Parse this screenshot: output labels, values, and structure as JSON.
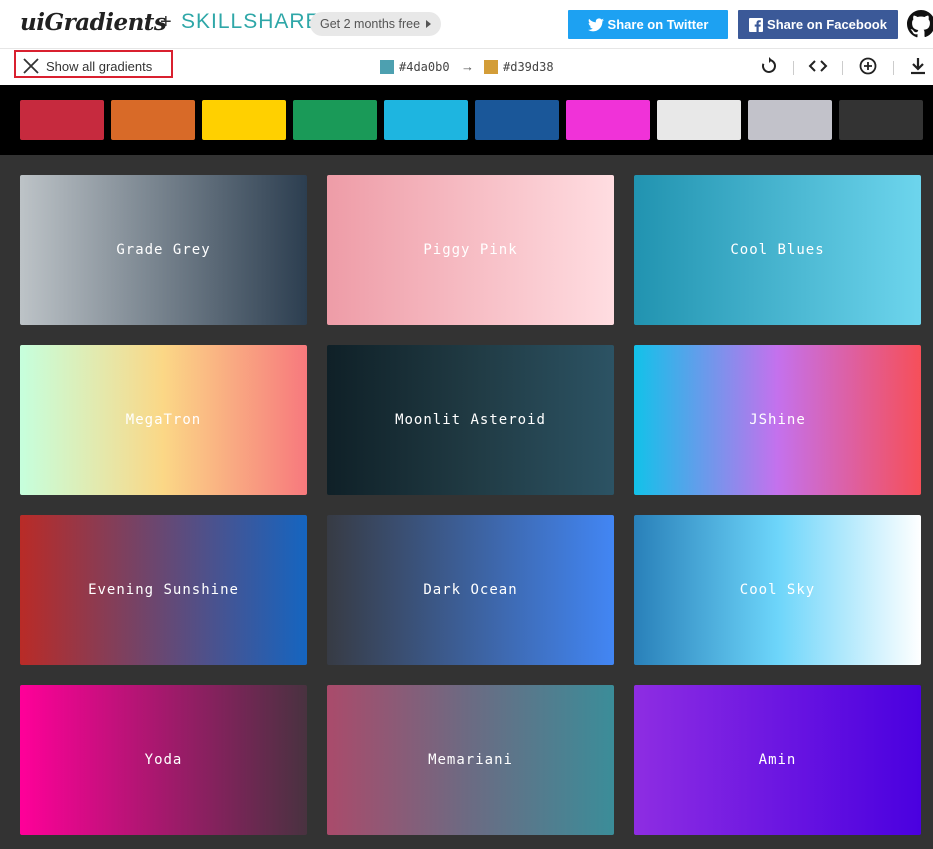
{
  "header": {
    "logo": "uiGradients",
    "plus": "+",
    "partner": "SKILLSHARE",
    "promo_label": "Get 2 months free",
    "twitter_label": "Share on Twitter",
    "facebook_label": "Share on Facebook",
    "github_icon": "github-icon"
  },
  "toolbar": {
    "show_all_label": "Show all gradients",
    "color_from": "#4da0b0",
    "color_to": "#d39d38",
    "arrow": "→",
    "icons": [
      "rotate-icon",
      "code-icon",
      "add-circle-icon",
      "download-icon"
    ]
  },
  "filter_colors": [
    "#c62a3e",
    "#d86a28",
    "#ffd000",
    "#1a9a58",
    "#1eb5e0",
    "#1a5799",
    "#f032d8",
    "#e8e8e8",
    "#c2c2ca",
    "#333333"
  ],
  "gradients": [
    {
      "name": "Grade Grey",
      "from": "#bdc3c7",
      "to": "#2c3e50"
    },
    {
      "name": "Piggy Pink",
      "from": "#ee9ca7",
      "to": "#ffdde1"
    },
    {
      "name": "Cool Blues",
      "from": "#2193b0",
      "to": "#6dd5ed"
    },
    {
      "name": "MegaTron",
      "from": "#c6ffdd",
      "mid": "#fbd786",
      "to": "#f7797d"
    },
    {
      "name": "Moonlit Asteroid",
      "from": "#0f2027",
      "mid": "#203a43",
      "to": "#2c5364"
    },
    {
      "name": "JShine",
      "from": "#12c2e9",
      "mid": "#c471ed",
      "to": "#f64f59"
    },
    {
      "name": "Evening Sunshine",
      "from": "#b92b27",
      "to": "#1565c0"
    },
    {
      "name": "Dark Ocean",
      "from": "#373b44",
      "to": "#4286f4"
    },
    {
      "name": "Cool Sky",
      "from": "#2980b9",
      "mid": "#6dd5fa",
      "to": "#ffffff"
    },
    {
      "name": "Yoda",
      "from": "#ff0099",
      "to": "#493240"
    },
    {
      "name": "Memariani",
      "from": "#aa4b6b",
      "mid": "#6b6b83",
      "to": "#3b8d99"
    },
    {
      "name": "Amin",
      "from": "#8e2de2",
      "to": "#4a00e0"
    }
  ]
}
